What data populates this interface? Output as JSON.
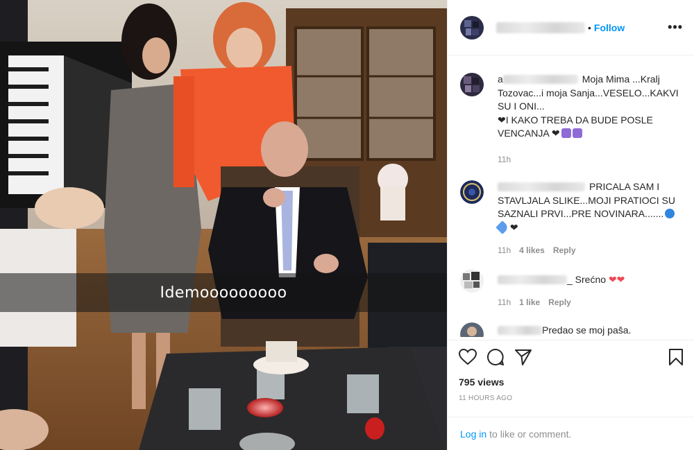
{
  "media": {
    "caption_text": "Idemooooooooo"
  },
  "header": {
    "follow_label": "Follow",
    "separator": "•",
    "more_label": "•••"
  },
  "comments": [
    {
      "username_visible": "a",
      "text": "Moja Mima ...Kralj Tozovac...i moja Sanja...VESELO...KAKVI SU I ONI...",
      "text_line2": "I KAKO TREBA DA BUDE POSLE VENCANJA",
      "time": "11h"
    },
    {
      "text": "PRICALA SAM I STAVLJALA SLIKE...MOJI PRATIOCI SU SAZNALI PRVI...PRE NOVINARA.......",
      "time": "11h",
      "likes": "4 likes",
      "reply": "Reply"
    },
    {
      "text": "_ Srećno",
      "time": "11h",
      "likes": "1 like",
      "reply": "Reply"
    },
    {
      "text": "Predao se moj paša."
    }
  ],
  "footer": {
    "views": "795 views",
    "time_ago": "11 HOURS AGO",
    "login_link": "Log in",
    "login_text": "to like or comment."
  },
  "icons": [
    "heart-icon",
    "comment-icon",
    "share-icon",
    "bookmark-icon"
  ],
  "colors": {
    "accent": "#0095f6",
    "heart": "#ed4956"
  }
}
